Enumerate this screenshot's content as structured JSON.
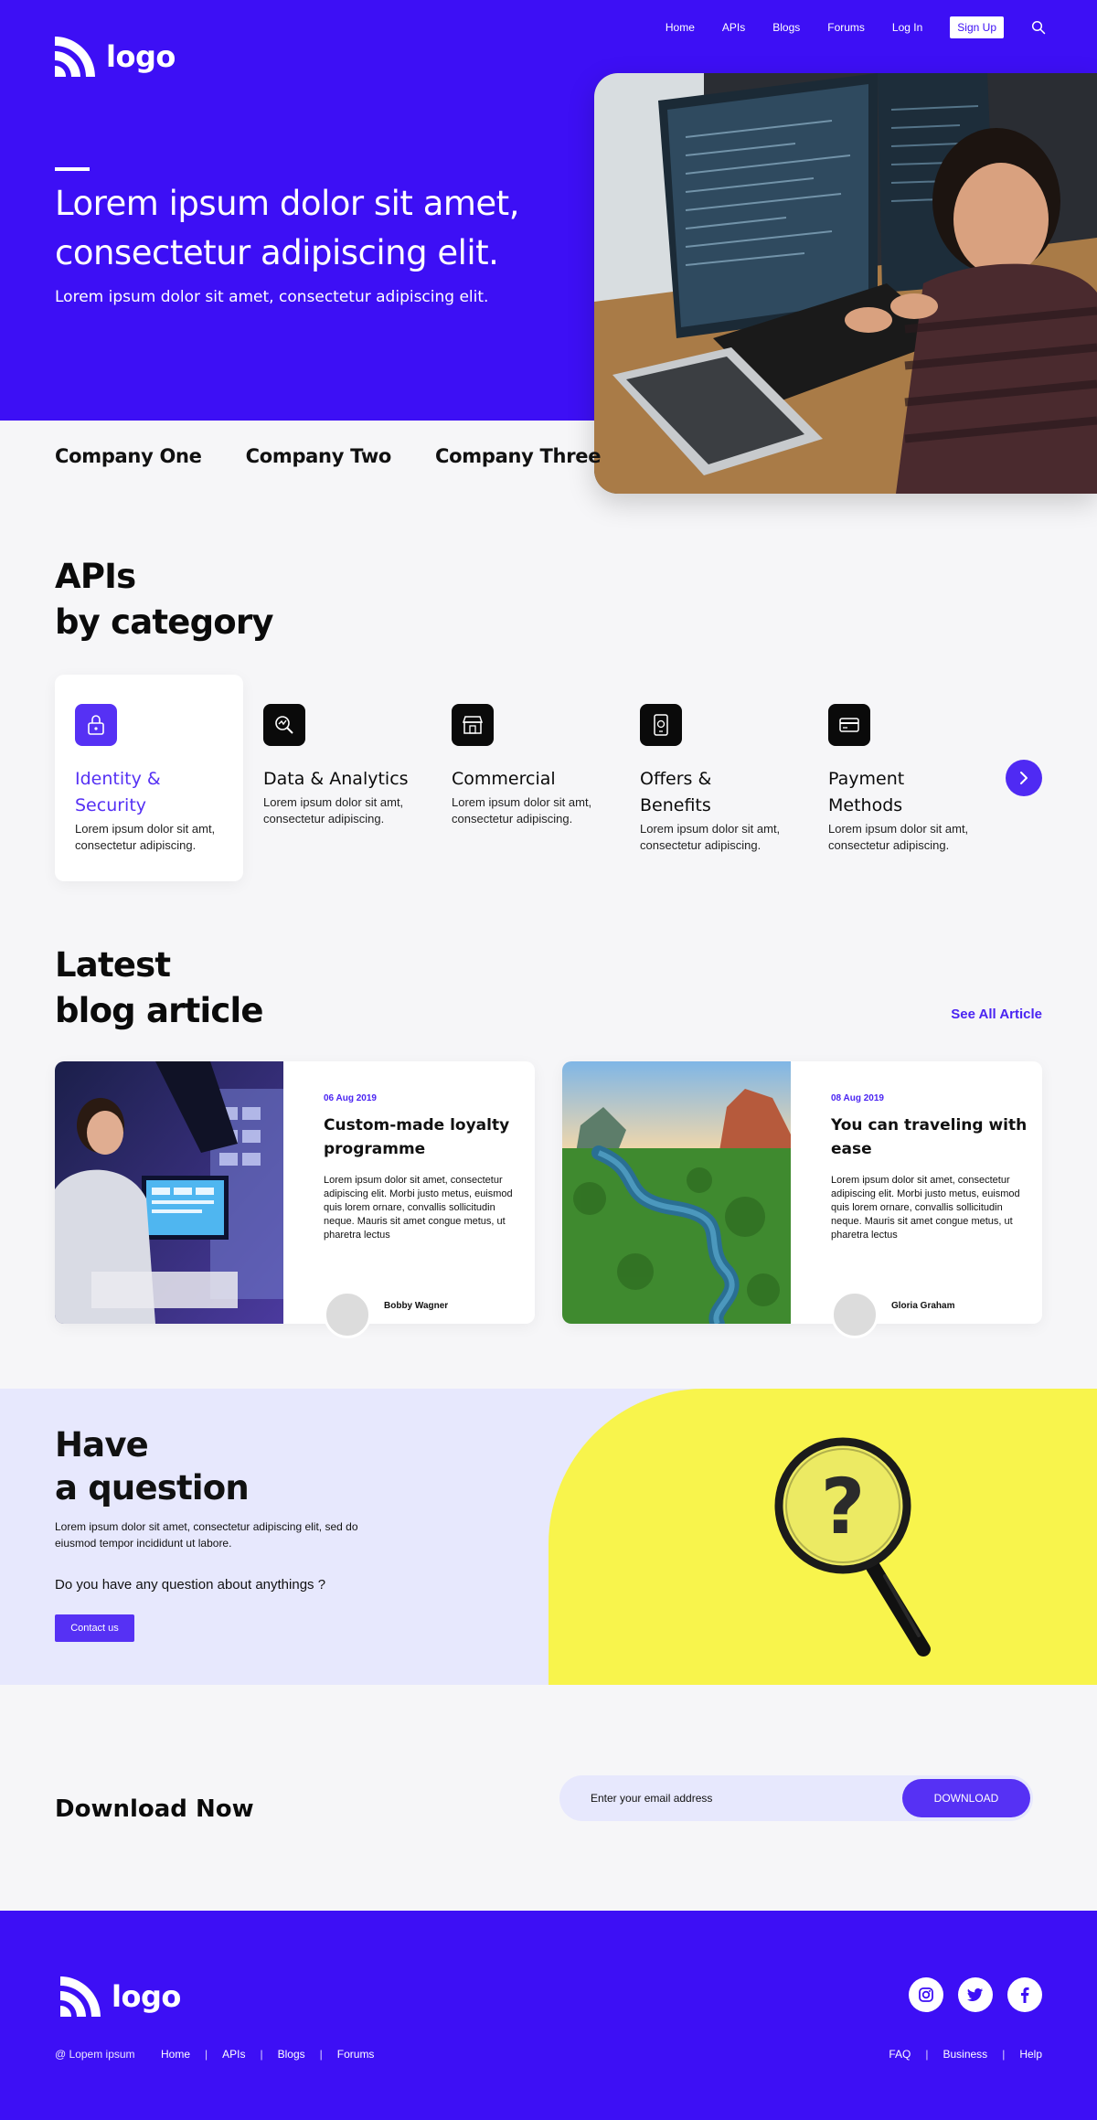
{
  "brand": {
    "logo_text": "logo"
  },
  "nav": {
    "items": [
      "Home",
      "APIs",
      "Blogs",
      "Forums",
      "Log In"
    ],
    "signup": "Sign Up",
    "search_icon": "search-icon"
  },
  "hero": {
    "title": "Lorem ipsum dolor sit amet, consectetur adipiscing elit.",
    "subtitle": "Lorem ipsum dolor sit amet, consectetur adipiscing elit."
  },
  "companies": [
    "Company One",
    "Company Two",
    "Company Three"
  ],
  "apis": {
    "title_line1": "APIs",
    "title_line2": "by category",
    "categories": [
      {
        "name": "Identity & Security",
        "desc": "Lorem ipsum dolor sit amt, consectetur adipiscing.",
        "icon": "lock-icon",
        "active": true
      },
      {
        "name": "Data & Analytics",
        "desc": "Lorem ipsum dolor sit amt, consectetur adipiscing.",
        "icon": "analytics-icon",
        "active": false
      },
      {
        "name": "Commercial",
        "desc": "Lorem ipsum dolor sit amt, consectetur adipiscing.",
        "icon": "store-icon",
        "active": false
      },
      {
        "name": "Offers & Benefits",
        "desc": "Lorem ipsum dolor sit amt, consectetur adipiscing.",
        "icon": "mobile-offer-icon",
        "active": false
      },
      {
        "name": "Payment Methods",
        "desc": "Lorem ipsum dolor sit amt, consectetur adipiscing.",
        "icon": "credit-card-icon",
        "active": false
      }
    ],
    "next_icon": "chevron-right-icon"
  },
  "blog": {
    "title_line1": "Latest",
    "title_line2": "blog article",
    "see_all": "See All Article",
    "posts": [
      {
        "date": "06 Aug 2019",
        "title": "Custom-made loyalty programme",
        "body": "Lorem ipsum dolor sit amet, consectetur adipiscing elit. Morbi justo metus, euismod quis lorem ornare, convallis sollicitudin neque. Mauris sit amet congue metus, ut pharetra lectus",
        "author": "Bobby Wagner"
      },
      {
        "date": "08 Aug 2019",
        "title": "You can traveling with ease",
        "body": "Lorem ipsum dolor sit amet, consectetur adipiscing elit. Morbi justo metus, euismod quis lorem ornare, convallis sollicitudin neque. Mauris sit amet congue metus, ut pharetra lectus",
        "author": "Gloria Graham"
      }
    ]
  },
  "question": {
    "title_line1": "Have",
    "title_line2": "a question",
    "desc": "Lorem ipsum dolor sit amet, consectetur adipiscing elit, sed do eiusmod tempor incididunt ut labore.",
    "ask": "Do you have any question about anythings ?",
    "button": "Contact us"
  },
  "download": {
    "title_bold": "Download",
    "title_rest": " Now",
    "placeholder": "Enter your email address",
    "button": "DOWNLOAD"
  },
  "footer": {
    "copyright": "@ Lopem ipsum",
    "links_left": [
      "Home",
      "APIs",
      "Blogs",
      "Forums"
    ],
    "links_right": [
      "FAQ",
      "Business",
      "Help"
    ],
    "socials": [
      "instagram-icon",
      "twitter-icon",
      "facebook-icon"
    ]
  },
  "colors": {
    "brand": "#3d0ff5",
    "accent": "#5631f4",
    "background": "#f6f6f8",
    "question_bg": "#e7e8fd",
    "yellow": "#f8f44c"
  }
}
